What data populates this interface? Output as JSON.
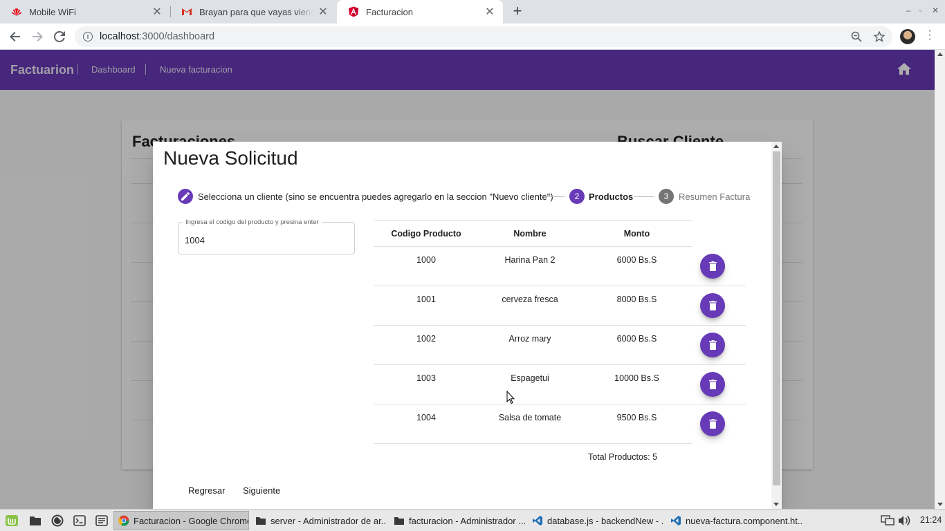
{
  "browser": {
    "tabs": [
      {
        "title": "Mobile WiFi",
        "icon": "huawei-icon"
      },
      {
        "title": "Brayan para que vayas viendo",
        "icon": "gmail-icon"
      },
      {
        "title": "Facturacion",
        "icon": "angular-icon",
        "active": true
      }
    ],
    "url_host": "localhost",
    "url_path": ":3000/dashboard"
  },
  "app": {
    "brand": "Factuarion",
    "nav": [
      "Dashboard",
      "Nueva facturacion"
    ],
    "accent_color": "#673ab7"
  },
  "background_card": {
    "title": "Facturaciones",
    "search_title": "Buscar Cliente"
  },
  "dialog": {
    "title": "Nueva Solicitud",
    "steps": [
      {
        "label": "Selecciona un cliente (sino se encuentra puedes agregarlo en la seccion \"Nuevo cliente\")",
        "state": "done",
        "icon": "pencil-icon"
      },
      {
        "label": "Productos",
        "number": "2",
        "state": "active"
      },
      {
        "label": "Resumen Factura",
        "number": "3",
        "state": "pending"
      }
    ],
    "input": {
      "label": "Ingresa el codigo del producto y presina enter",
      "value": "1004"
    },
    "table": {
      "headers": [
        "Codigo Producto",
        "Nombre",
        "Monto"
      ],
      "rows": [
        {
          "code": "1000",
          "name": "Harina Pan 2",
          "amount": "6000 Bs.S"
        },
        {
          "code": "1001",
          "name": "cerveza fresca",
          "amount": "8000 Bs.S"
        },
        {
          "code": "1002",
          "name": "Arroz mary",
          "amount": "6000 Bs.S"
        },
        {
          "code": "1003",
          "name": "Espagetui",
          "amount": "10000 Bs.S"
        },
        {
          "code": "1004",
          "name": "Salsa de tomate",
          "amount": "9500 Bs.S"
        }
      ]
    },
    "total": "Total Productos: 5",
    "back_label": "Regresar",
    "next_label": "Siguiente"
  },
  "taskbar": {
    "items": [
      {
        "label": "Facturacion - Google Chrome",
        "icon": "chrome-icon",
        "active": true
      },
      {
        "label": "server - Administrador de ar...",
        "icon": "folder-icon"
      },
      {
        "label": "facturacion - Administrador ...",
        "icon": "folder-icon"
      },
      {
        "label": "database.js - backendNew - ...",
        "icon": "vscode-icon"
      },
      {
        "label": "nueva-factura.component.ht...",
        "icon": "vscode-icon"
      }
    ],
    "clock": "21:24"
  }
}
